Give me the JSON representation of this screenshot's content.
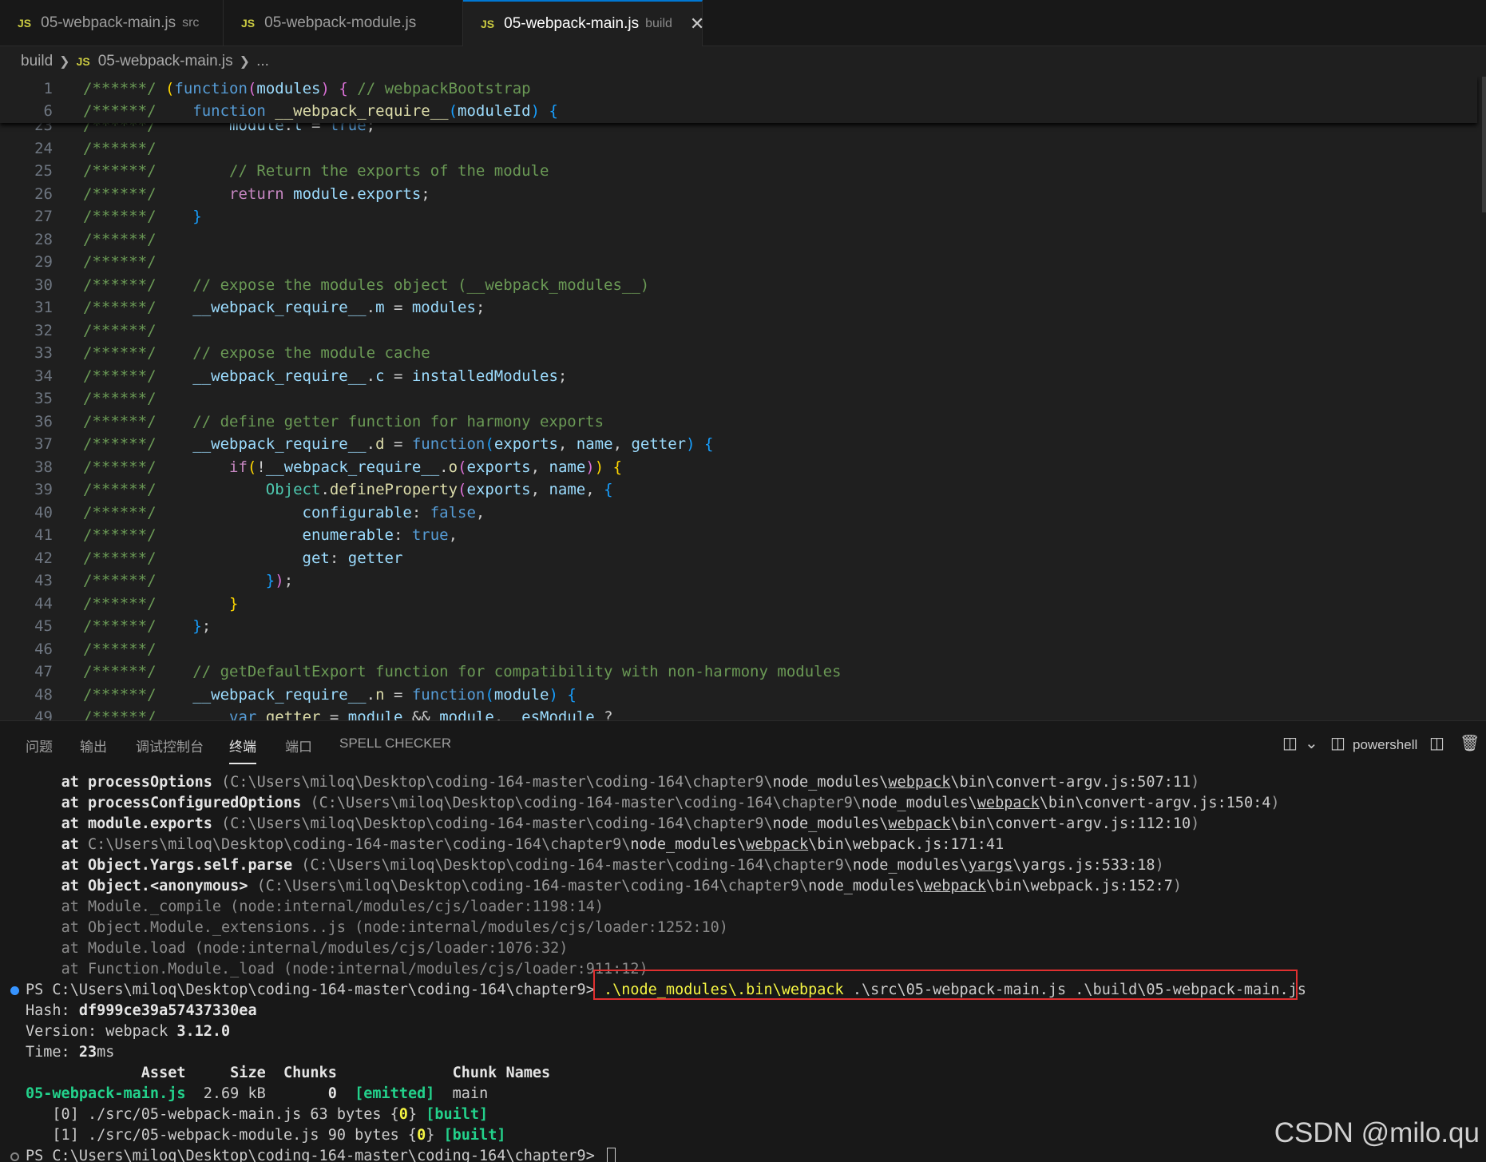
{
  "tabs": [
    {
      "label": "05-webpack-main.js",
      "description": "src",
      "badge": "JS"
    },
    {
      "label": "05-webpack-module.js",
      "description": "",
      "badge": "JS"
    },
    {
      "label": "05-webpack-main.js",
      "description": "build",
      "badge": "JS",
      "close": "✕"
    }
  ],
  "breadcrumb": {
    "folder": "build",
    "file": "05-webpack-main.js",
    "more": "...",
    "badge": "JS"
  },
  "sticky_lines": [
    {
      "n": "1",
      "html": "<span class='c-com'>/******/</span> <span class='c-p1'>(</span><span class='c-kw'>function</span><span class='c-p2'>(</span><span class='c-var'>modules</span><span class='c-p2'>)</span> <span class='c-p2'>{</span> <span class='c-com'>// webpackBootstrap</span>"
    },
    {
      "n": "6",
      "html": "<span class='c-com'>/******/</span>    <span class='c-kw'>function</span> <span class='c-fn'>__webpack_require__</span><span class='c-p3'>(</span><span class='c-var'>moduleId</span><span class='c-p3'>)</span> <span class='c-p3'>{</span>"
    }
  ],
  "code_lines": [
    {
      "n": "23",
      "html": "<span class='c-com'>/******/</span>        <span class='c-var'>module</span>.<span class='c-var'>l</span> = <span class='c-kw'>true</span>;"
    },
    {
      "n": "24",
      "html": "<span class='c-com'>/******/</span>"
    },
    {
      "n": "25",
      "html": "<span class='c-com'>/******/</span>        <span class='c-com'>// Return the exports of the module</span>"
    },
    {
      "n": "26",
      "html": "<span class='c-com'>/******/</span>        <span class='c-ctl'>return</span> <span class='c-var'>module</span>.<span class='c-var'>exports</span>;"
    },
    {
      "n": "27",
      "html": "<span class='c-com'>/******/</span>    <span class='c-p3'>}</span>"
    },
    {
      "n": "28",
      "html": "<span class='c-com'>/******/</span>"
    },
    {
      "n": "29",
      "html": "<span class='c-com'>/******/</span>"
    },
    {
      "n": "30",
      "html": "<span class='c-com'>/******/</span>    <span class='c-com'>// expose the modules object (__webpack_modules__)</span>"
    },
    {
      "n": "31",
      "html": "<span class='c-com'>/******/</span>    <span class='c-var'>__webpack_require__</span>.<span class='c-var'>m</span> = <span class='c-var'>modules</span>;"
    },
    {
      "n": "32",
      "html": "<span class='c-com'>/******/</span>"
    },
    {
      "n": "33",
      "html": "<span class='c-com'>/******/</span>    <span class='c-com'>// expose the module cache</span>"
    },
    {
      "n": "34",
      "html": "<span class='c-com'>/******/</span>    <span class='c-var'>__webpack_require__</span>.<span class='c-var'>c</span> = <span class='c-var'>installedModules</span>;"
    },
    {
      "n": "35",
      "html": "<span class='c-com'>/******/</span>"
    },
    {
      "n": "36",
      "html": "<span class='c-com'>/******/</span>    <span class='c-com'>// define getter function for harmony exports</span>"
    },
    {
      "n": "37",
      "html": "<span class='c-com'>/******/</span>    <span class='c-var'>__webpack_require__</span>.<span class='c-fn'>d</span> = <span class='c-kw'>function</span><span class='c-p3'>(</span><span class='c-var'>exports</span>, <span class='c-var'>name</span>, <span class='c-var'>getter</span><span class='c-p3'>)</span> <span class='c-p3'>{</span>"
    },
    {
      "n": "38",
      "html": "<span class='c-com'>/******/</span>        <span class='c-ctl'>if</span><span class='c-p1'>(</span>!<span class='c-var'>__webpack_require__</span>.<span class='c-fn'>o</span><span class='c-p2'>(</span><span class='c-var'>exports</span>, <span class='c-var'>name</span><span class='c-p2'>)</span><span class='c-p1'>)</span> <span class='c-p1'>{</span>"
    },
    {
      "n": "39",
      "html": "<span class='c-com'>/******/</span>            <span class='c-cls'>Object</span>.<span class='c-fn'>defineProperty</span><span class='c-p2'>(</span><span class='c-var'>exports</span>, <span class='c-var'>name</span>, <span class='c-p3'>{</span>"
    },
    {
      "n": "40",
      "html": "<span class='c-com'>/******/</span>                <span class='c-var'>configurable</span>: <span class='c-kw'>false</span>,"
    },
    {
      "n": "41",
      "html": "<span class='c-com'>/******/</span>                <span class='c-var'>enumerable</span>: <span class='c-kw'>true</span>,"
    },
    {
      "n": "42",
      "html": "<span class='c-com'>/******/</span>                <span class='c-var'>get</span>: <span class='c-var'>getter</span>"
    },
    {
      "n": "43",
      "html": "<span class='c-com'>/******/</span>            <span class='c-p3'>}</span><span class='c-p2'>)</span>;"
    },
    {
      "n": "44",
      "html": "<span class='c-com'>/******/</span>        <span class='c-p1'>}</span>"
    },
    {
      "n": "45",
      "html": "<span class='c-com'>/******/</span>    <span class='c-p3'>}</span>;"
    },
    {
      "n": "46",
      "html": "<span class='c-com'>/******/</span>"
    },
    {
      "n": "47",
      "html": "<span class='c-com'>/******/</span>    <span class='c-com'>// getDefaultExport function for compatibility with non-harmony modules</span>"
    },
    {
      "n": "48",
      "html": "<span class='c-com'>/******/</span>    <span class='c-var'>__webpack_require__</span>.<span class='c-fn'>n</span> = <span class='c-kw'>function</span><span class='c-p3'>(</span><span class='c-var'>module</span><span class='c-p3'>)</span> <span class='c-p3'>{</span>"
    },
    {
      "n": "49",
      "html": "<span class='c-com'>/******/</span>        <span class='c-kw'>var</span> <span class='c-fn'>getter</span> = <span class='c-var'>module</span> &amp;&amp; <span class='c-var'>module</span>.<span class='c-var'>__esModule</span> ?"
    }
  ],
  "panel": {
    "tabs": [
      "问题",
      "输出",
      "调试控制台",
      "终端",
      "端口",
      "SPELL CHECKER"
    ],
    "active_tab": "终端",
    "shell": "powershell",
    "icons": [
      "split-editor-icon",
      "chevron-down-icon",
      "terminal-icon",
      "split-terminal-icon",
      "trash-icon"
    ]
  },
  "terminal_lines": [
    {
      "html": "    <span class='t-bold'>at processOptions</span> <span class='t-path'>(C:\\Users\\miloq\\Desktop\\coding-164-master\\coding-164\\chapter9\\</span>node_modules\\<span class='t-under'>webpack</span>\\bin\\convert-argv.js:507:11<span class='t-path'>)</span>"
    },
    {
      "html": "    <span class='t-bold'>at processConfiguredOptions</span> <span class='t-path'>(C:\\Users\\miloq\\Desktop\\coding-164-master\\coding-164\\chapter9\\</span>node_modules\\<span class='t-under'>webpack</span>\\bin\\convert-argv.js:150:4<span class='t-path'>)</span>"
    },
    {
      "html": "    <span class='t-bold'>at module.exports</span> <span class='t-path'>(C:\\Users\\miloq\\Desktop\\coding-164-master\\coding-164\\chapter9\\</span>node_modules\\<span class='t-under'>webpack</span>\\bin\\convert-argv.js:112:10<span class='t-path'>)</span>"
    },
    {
      "html": "    <span class='t-bold'>at</span> <span class='t-path'>C:\\Users\\miloq\\Desktop\\coding-164-master\\coding-164\\chapter9\\</span>node_modules\\<span class='t-under'>webpack</span>\\bin\\webpack.js:171:41"
    },
    {
      "html": "    <span class='t-bold'>at Object.Yargs.self.parse</span> <span class='t-path'>(C:\\Users\\miloq\\Desktop\\coding-164-master\\coding-164\\chapter9\\</span>node_modules\\<span class='t-under'>yargs</span>\\yargs.js:533:18<span class='t-path'>)</span>"
    },
    {
      "html": "    <span class='t-bold'>at Object.&lt;anonymous&gt;</span> <span class='t-path'>(C:\\Users\\miloq\\Desktop\\coding-164-master\\coding-164\\chapter9\\</span>node_modules\\<span class='t-under'>webpack</span>\\bin\\webpack.js:152:7<span class='t-path'>)</span>"
    },
    {
      "html": "    <span class='t-dim'>at Module._compile (node:internal/modules/cjs/loader:1198:14)</span>"
    },
    {
      "html": "    <span class='t-dim'>at Object.Module._extensions..js (node:internal/modules/cjs/loader:1252:10)</span>"
    },
    {
      "html": "    <span class='t-dim'>at Module.load (node:internal/modules/cjs/loader:1076:32)</span>"
    },
    {
      "html": "    <span class='t-dim'>at Function.Module._load (node:internal/modules/cjs/loader:911:12)</span>"
    },
    {
      "html": "PS C:\\Users\\miloq\\Desktop\\coding-164-master\\coding-164\\chapter9&gt; <span class='t-cmd'>.\\node_modules\\.bin\\webpack</span> .\\src\\05-webpack-main.js .\\build\\05-webpack-main.js",
      "dot": "blue"
    },
    {
      "html": "Hash: <span class='t-bold'>df999ce39a57437330ea</span>"
    },
    {
      "html": "Version: webpack <span class='t-bold'>3.12.0</span>"
    },
    {
      "html": "Time: <span class='t-bold'>23</span>ms"
    },
    {
      "html": "<span class='t-bold'>             Asset     Size  Chunks             Chunk Names</span>"
    },
    {
      "html": "<span class='t-green'>05-webpack-main.js</span>  2.69 kB       <span class='t-bold'>0</span>  <span class='t-green'>[emitted]</span>  main"
    },
    {
      "html": "   [0] ./src/05-webpack-main.js 63 bytes {<span class='t-yellow'>0</span>} <span class='t-green'>[built]</span>"
    },
    {
      "html": "   [1] ./src/05-webpack-module.js 90 bytes {<span class='t-yellow'>0</span>} <span class='t-green'>[built]</span>"
    },
    {
      "html": "PS C:\\Users\\miloq\\Desktop\\coding-164-master\\coding-164\\chapter9&gt; <span id='cursor' data-name='terminal-cursor' data-interactable='false'></span>",
      "dot": "grey"
    }
  ],
  "watermark": "CSDN @milo.qu"
}
